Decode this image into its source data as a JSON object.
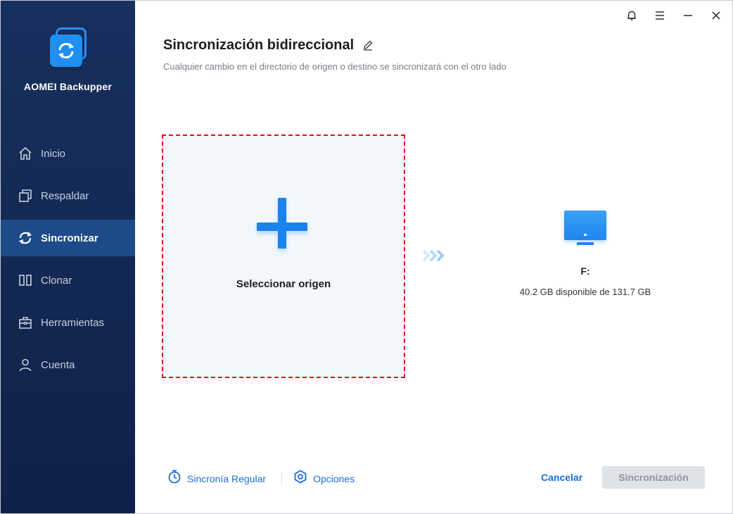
{
  "app": {
    "name": "AOMEI Backupper"
  },
  "sidebar": {
    "items": [
      {
        "label": "Inicio",
        "icon": "home-icon",
        "active": false
      },
      {
        "label": "Respaldar",
        "icon": "backup-icon",
        "active": false
      },
      {
        "label": "Sincronizar",
        "icon": "sync-icon",
        "active": true
      },
      {
        "label": "Clonar",
        "icon": "clone-icon",
        "active": false
      },
      {
        "label": "Herramientas",
        "icon": "toolbox-icon",
        "active": false
      },
      {
        "label": "Cuenta",
        "icon": "user-icon",
        "active": false
      }
    ]
  },
  "titlebar": {
    "icons": [
      "bell-icon",
      "menu-icon",
      "minimize-icon",
      "close-icon"
    ]
  },
  "main": {
    "title": "Sincronización bidireccional",
    "subtitle": "Cualquier cambio en el directorio de origen o destino se sincronizará con el otro lado",
    "source": {
      "label": "Seleccionar origen"
    },
    "destination": {
      "name": "F:",
      "space": "40.2 GB disponible de 131.7 GB"
    }
  },
  "footer": {
    "schedule_label": "Sincronía Regular",
    "options_label": "Opciones",
    "cancel_label": "Cancelar",
    "sync_label": "Sincronización"
  },
  "colors": {
    "sidebar_bg": "#142a55",
    "sidebar_active": "#1e4a8a",
    "accent": "#1a83f0",
    "link": "#1a6fd6",
    "dashed_border": "#e0111b",
    "disabled_button": "#dfe2e7"
  }
}
